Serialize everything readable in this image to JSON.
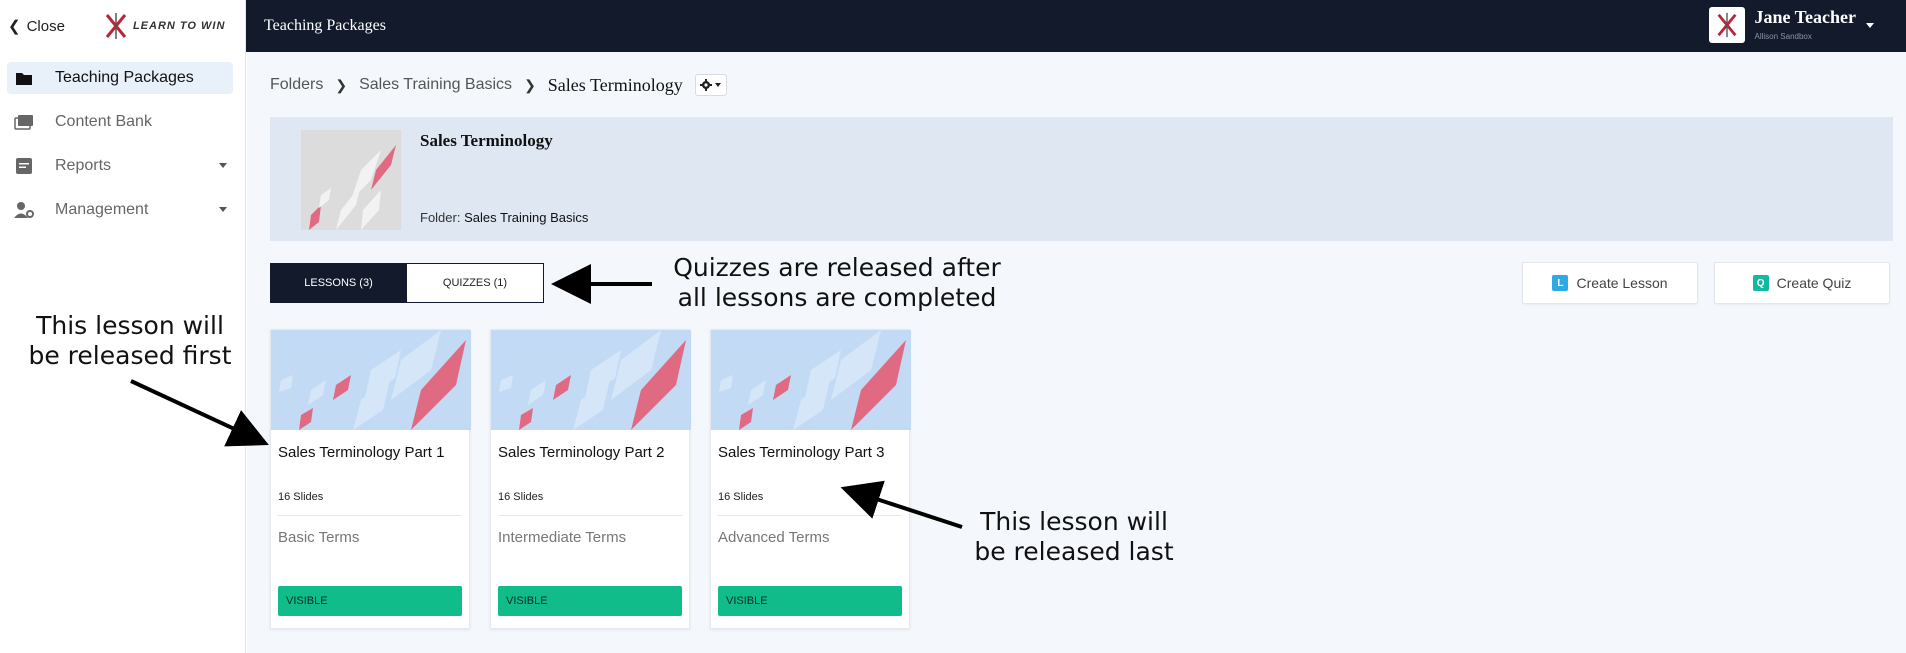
{
  "sidebar": {
    "close_label": "Close",
    "logo_text": "LEARN TO WIN",
    "items": [
      {
        "label": "Teaching Packages",
        "icon": "folder-icon",
        "active": true
      },
      {
        "label": "Content Bank",
        "icon": "images-icon"
      },
      {
        "label": "Reports",
        "icon": "report-icon",
        "has_caret": true
      },
      {
        "label": "Management",
        "icon": "user-gear-icon",
        "has_caret": true
      }
    ]
  },
  "topbar": {
    "title": "Teaching Packages",
    "user_name": "Jane Teacher",
    "user_sub": "Allison Sandbox"
  },
  "breadcrumb": {
    "items": [
      "Folders",
      "Sales Training Basics"
    ],
    "current": "Sales Terminology"
  },
  "package": {
    "title": "Sales Terminology",
    "folder_label": "Folder:",
    "folder_name": "Sales Training Basics"
  },
  "tabs": [
    {
      "label": "LESSONS (3)",
      "active": true
    },
    {
      "label": "QUIZZES (1)",
      "active": false
    }
  ],
  "actions": {
    "create_lesson": "Create Lesson",
    "create_lesson_badge": "L",
    "create_quiz": "Create Quiz",
    "create_quiz_badge": "Q"
  },
  "lessons": [
    {
      "title": "Sales Terminology Part 1",
      "slides": "16 Slides",
      "description": "Basic Terms",
      "status": "VISIBLE"
    },
    {
      "title": "Sales Terminology Part 2",
      "slides": "16 Slides",
      "description": "Intermediate Terms",
      "status": "VISIBLE"
    },
    {
      "title": "Sales Terminology Part 3",
      "slides": "16 Slides",
      "description": "Advanced Terms",
      "status": "VISIBLE"
    }
  ],
  "annotations": {
    "quizzes_line1": "Quizzes are released after",
    "quizzes_line2": "all lessons are completed",
    "first_line1": "This lesson will",
    "first_line2": "be released first",
    "last_line1": "This lesson will",
    "last_line2": "be released last"
  },
  "colors": {
    "topbar": "#121a2c",
    "visible_green": "#10bc8a",
    "lesson_badge": "#2fa8e6",
    "quiz_badge": "#12b8a0"
  }
}
